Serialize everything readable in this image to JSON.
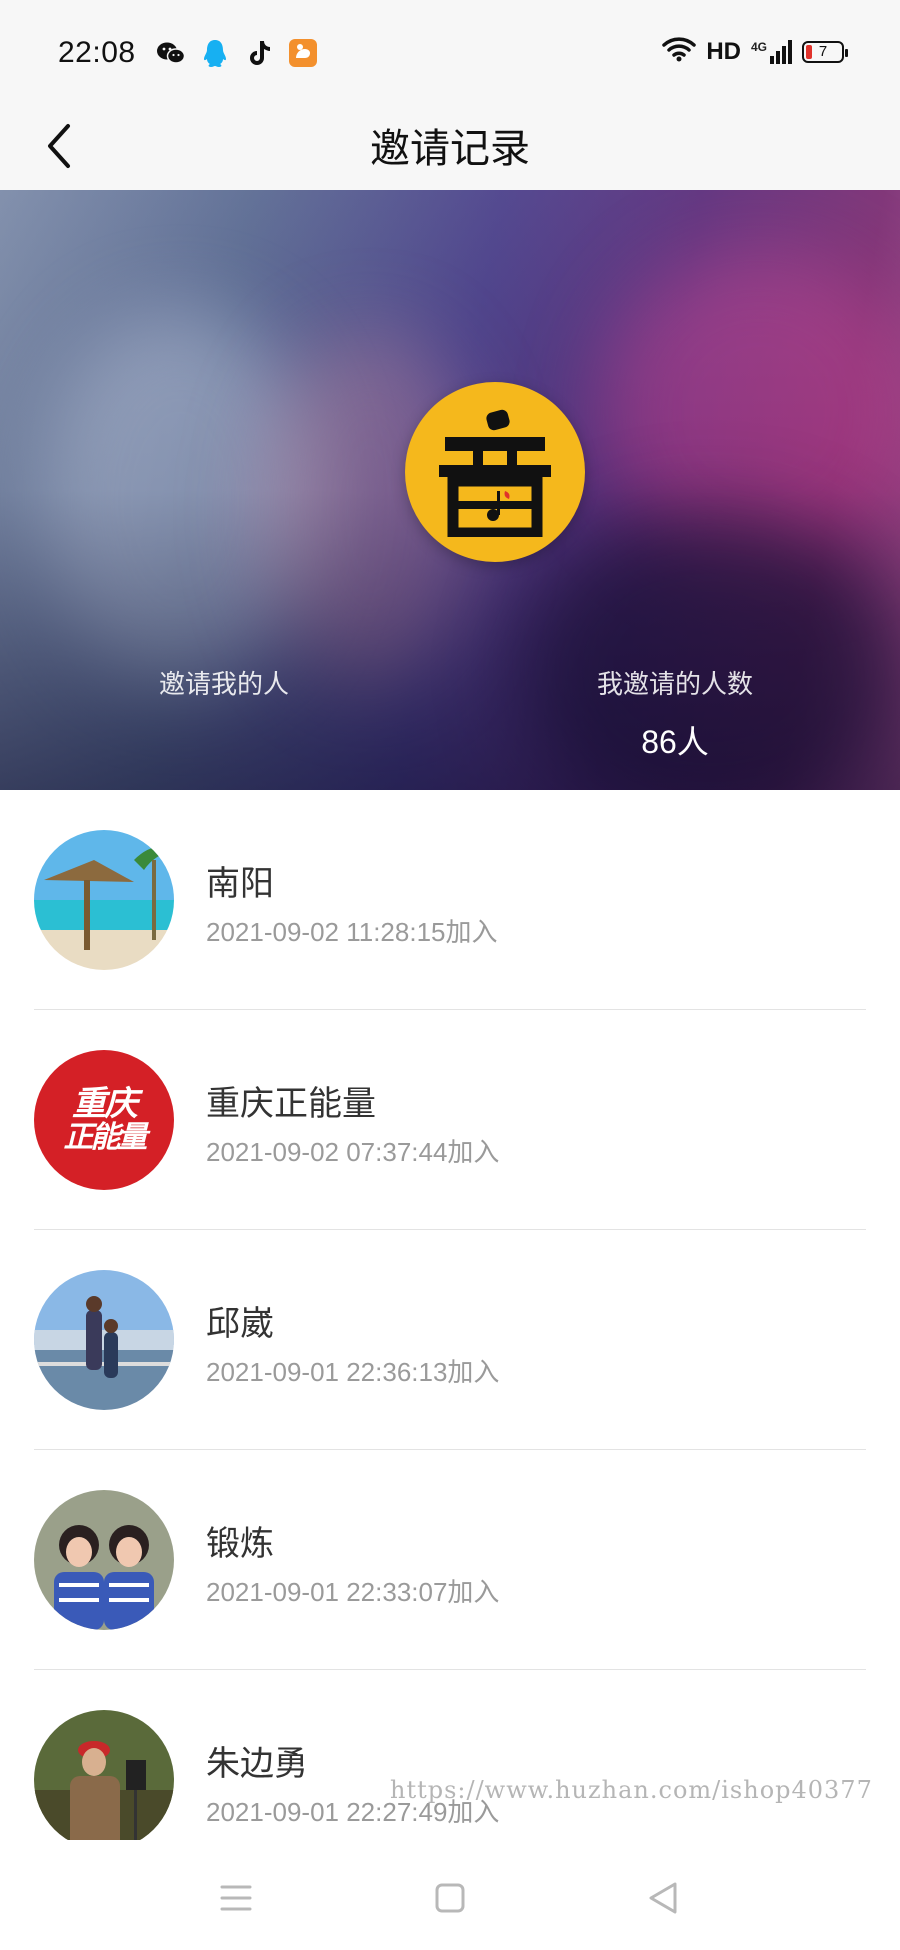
{
  "status_bar": {
    "time": "22:08",
    "apps": [
      "wechat-icon",
      "qq-icon",
      "tiktok-icon",
      "uc-browser-icon"
    ],
    "network": "HD",
    "network_type": "4G",
    "battery": "7",
    "battery_color": "#e0322b"
  },
  "nav": {
    "title": "邀请记录",
    "back_icon": "back-chevron-icon"
  },
  "hero": {
    "logo_char": "音",
    "logo_color": "#f5b81c",
    "inviter_label": "邀请我的人",
    "inviter_value": "",
    "invited_label": "我邀请的人数",
    "invited_value": "86人"
  },
  "invitees": [
    {
      "name": "南阳",
      "time": "2021-09-02 11:28:15加入"
    },
    {
      "name": "重庆正能量",
      "time": "2021-09-02 07:37:44加入"
    },
    {
      "name": "邱崴",
      "time": "2021-09-01 22:36:13加入"
    },
    {
      "name": "锻炼",
      "time": "2021-09-01 22:33:07加入"
    },
    {
      "name": "朱边勇",
      "time": "2021-09-01 22:27:49加入"
    }
  ],
  "avatar_badge": {
    "line1": "重庆",
    "line2": "正能量"
  },
  "watermark": "https://www.huzhan.com/ishop40377",
  "bottom_nav": [
    "menu-icon",
    "home-icon",
    "back-triangle-icon"
  ]
}
